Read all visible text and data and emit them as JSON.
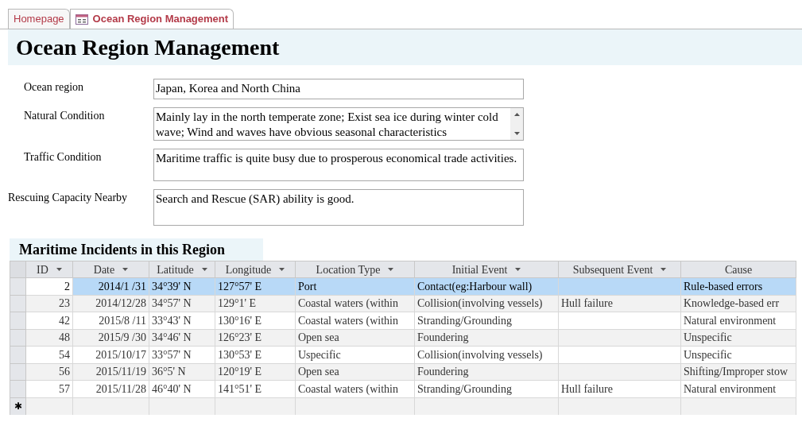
{
  "tabs": [
    {
      "label": "Homepage",
      "selected": false
    },
    {
      "label": "Ocean Region Management",
      "selected": true
    }
  ],
  "title": "Ocean Region Management",
  "fields": [
    {
      "label": "Ocean region",
      "value": "Japan, Korea and North China",
      "kind": "line"
    },
    {
      "label": "Natural Condition",
      "value": "Mainly lay in the north temperate zone; Exist sea ice during winter cold wave; Wind and waves have obvious seasonal characteristics",
      "kind": "scroll"
    },
    {
      "label": "Traffic Condition",
      "value": "Maritime traffic is quite busy due to prosperous economical trade activities.",
      "kind": "area"
    },
    {
      "label": "Rescuing Capacity Nearby",
      "value": "Search and Rescue (SAR) ability is good.",
      "kind": "area"
    }
  ],
  "incidents": {
    "title": "Maritime Incidents in this Region",
    "columns": [
      {
        "label": "ID",
        "filter": true
      },
      {
        "label": "Date",
        "filter": true
      },
      {
        "label": "Latitude",
        "filter": true
      },
      {
        "label": "Longitude",
        "filter": true
      },
      {
        "label": "Location Type",
        "filter": true
      },
      {
        "label": "Initial Event",
        "filter": true
      },
      {
        "label": "Subsequent Event",
        "filter": true
      },
      {
        "label": "Cause",
        "filter": false
      }
    ],
    "rows": [
      {
        "selected": true,
        "cells": [
          "2",
          "2014/1 /31",
          "34°39' N",
          "127°57' E",
          "Port",
          "Contact(eg:Harbour wall)",
          "",
          "Rule-based errors"
        ]
      },
      {
        "selected": false,
        "cells": [
          "23",
          "2014/12/28",
          "34°57' N",
          "129°1' E",
          "Coastal waters (within",
          "Collision(involving vessels)",
          "Hull failure",
          "Knowledge-based err"
        ]
      },
      {
        "selected": false,
        "cells": [
          "42",
          "2015/8 /11",
          "33°43' N",
          "130°16' E",
          "Coastal waters (within",
          "Stranding/Grounding",
          "",
          "Natural environment"
        ]
      },
      {
        "selected": false,
        "cells": [
          "48",
          "2015/9 /30",
          "34°46' N",
          "126°23' E",
          "Open sea",
          "Foundering",
          "",
          "Unspecific"
        ]
      },
      {
        "selected": false,
        "cells": [
          "54",
          "2015/10/17",
          "33°57' N",
          "130°53' E",
          "Uspecific",
          "Collision(involving vessels)",
          "",
          "Unspecific"
        ]
      },
      {
        "selected": false,
        "cells": [
          "56",
          "2015/11/19",
          "36°5' N",
          "120°19' E",
          "Open sea",
          "Foundering",
          "",
          "Shifting/Improper stow"
        ]
      },
      {
        "selected": false,
        "cells": [
          "57",
          "2015/11/28",
          "46°40' N",
          "141°51' E",
          "Coastal waters (within",
          "Stranding/Grounding",
          "Hull failure",
          "Natural environment"
        ]
      }
    ],
    "new_row_marker": "✱"
  }
}
